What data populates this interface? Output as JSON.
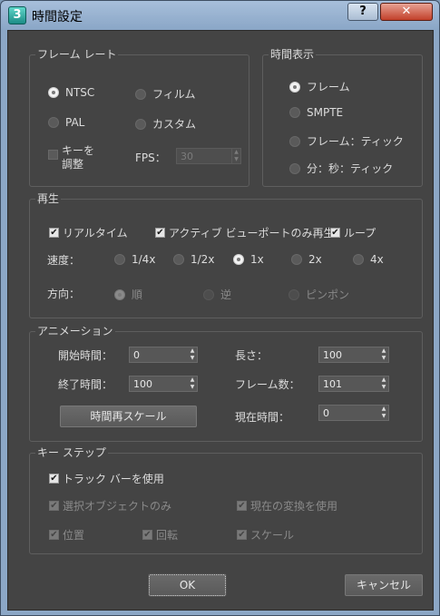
{
  "window": {
    "title": "時間設定",
    "icon_label": "3",
    "help_label": "?",
    "close_label": "✕"
  },
  "frame_rate": {
    "label": "フレーム レート",
    "options": [
      "NTSC",
      "フィルム",
      "PAL",
      "カスタム"
    ],
    "selected": "NTSC",
    "key_adjust_label_1": "キーを",
    "key_adjust_label_2": "調整",
    "fps_label": "FPS：",
    "fps_value": "30"
  },
  "time_display": {
    "label": "時間表示",
    "options": [
      "フレーム",
      "SMPTE",
      "フレーム：ティック",
      "分：秒：ティック"
    ],
    "selected": "フレーム"
  },
  "playback": {
    "label": "再生",
    "realtime_label": "リアルタイム",
    "active_viewport_label": "アクティブ ビューポートのみ再生",
    "loop_label": "ループ",
    "speed_label": "速度：",
    "speeds": [
      "1/4x",
      "1/2x",
      "1x",
      "2x",
      "4x"
    ],
    "speed_selected": "1x",
    "direction_label": "方向：",
    "directions": [
      "順",
      "逆",
      "ピンポン"
    ],
    "direction_selected": "順"
  },
  "animation": {
    "label": "アニメーション",
    "start_time_label": "開始時間：",
    "start_time": "0",
    "end_time_label": "終了時間：",
    "end_time": "100",
    "length_label": "長さ：",
    "length": "100",
    "frame_count_label": "フレーム数：",
    "frame_count": "101",
    "rescale_label": "時間再スケール",
    "current_time_label": "現在時間：",
    "current_time": "0"
  },
  "key_steps": {
    "label": "キー ステップ",
    "use_trackbar_label": "トラック バーを使用",
    "selected_only_label": "選択オブジェクトのみ",
    "use_current_transform_label": "現在の変換を使用",
    "position_label": "位置",
    "rotation_label": "回転",
    "scale_label": "スケール"
  },
  "footer": {
    "ok_label": "OK",
    "cancel_label": "キャンセル"
  }
}
